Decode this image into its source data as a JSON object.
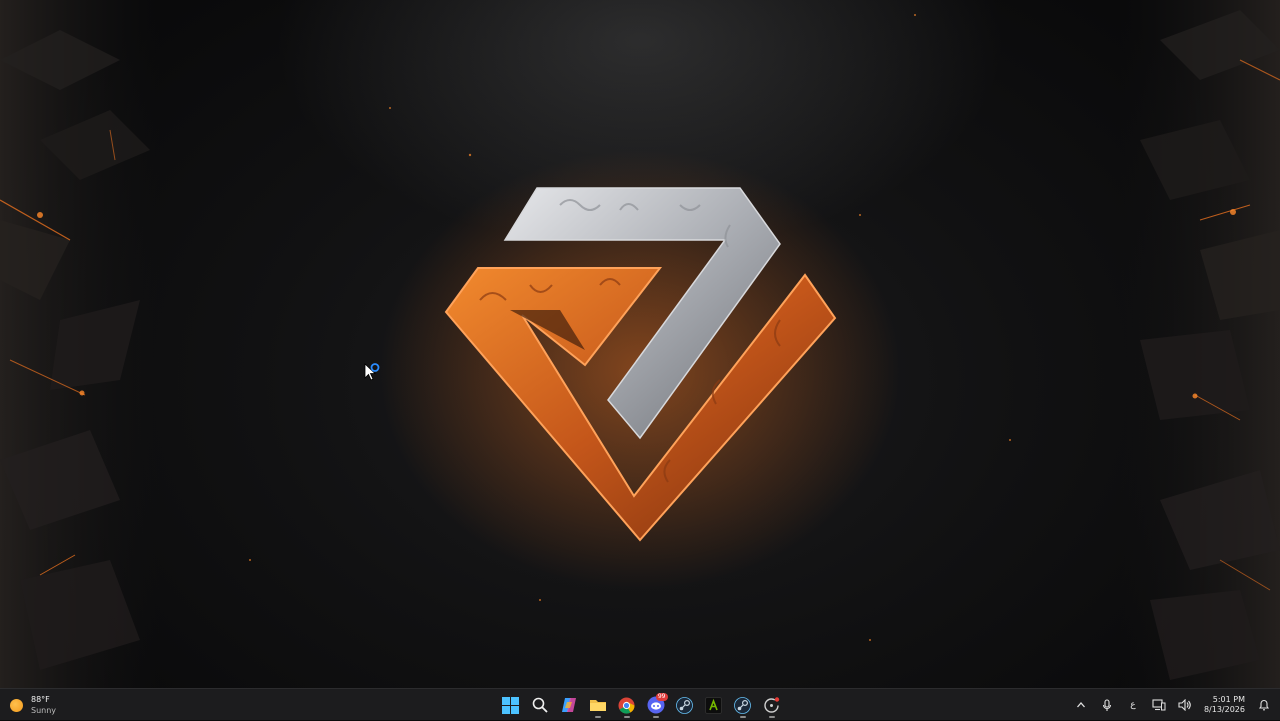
{
  "desktop": {
    "wallpaper": "abstract-glowing-triangle-logo",
    "accent_orange": "#e8701f",
    "accent_silver": "#b9bcc0"
  },
  "taskbar": {
    "weather": {
      "temperature": "88°F",
      "condition": "Sunny",
      "icon": "sun-icon"
    },
    "apps": [
      {
        "name": "start-button",
        "icon": "windows-logo-icon"
      },
      {
        "name": "search-button",
        "icon": "search-icon"
      },
      {
        "name": "copilot-button",
        "icon": "copilot-icon"
      },
      {
        "name": "file-explorer-button",
        "icon": "folder-icon"
      },
      {
        "name": "chrome-button",
        "icon": "chrome-icon"
      },
      {
        "name": "discord-button",
        "icon": "discord-icon",
        "badge": "99"
      },
      {
        "name": "steam-button",
        "icon": "steam-icon"
      },
      {
        "name": "nvidia-button",
        "icon": "nvidia-icon"
      },
      {
        "name": "steam-2-button",
        "icon": "steam-icon"
      },
      {
        "name": "app-update-button",
        "icon": "refresh-icon"
      }
    ],
    "system_tray": {
      "overflow_icon": "chevron-up-icon",
      "mic_icon": "microphone-icon",
      "language": "ع",
      "network_icon": "network-icon",
      "volume_icon": "volume-icon",
      "notification_icon": "notification-icon"
    },
    "clock": {
      "time": "5:01 PM",
      "date": "8/13/2026"
    }
  }
}
